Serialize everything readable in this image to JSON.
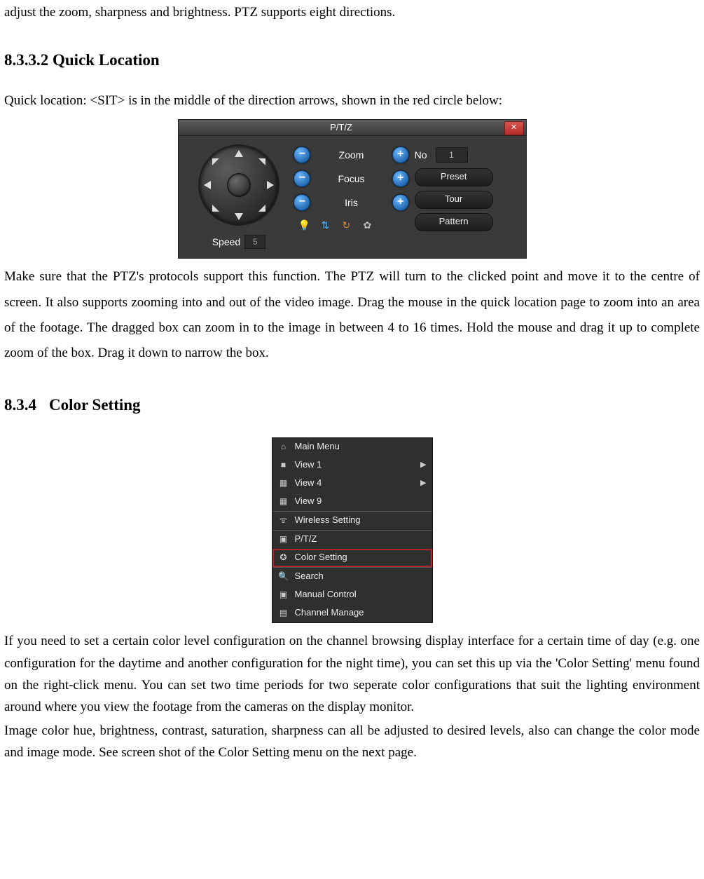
{
  "intro_line": "adjust the zoom, sharpness and brightness. PTZ supports eight directions.",
  "heading_quick_location": "8.3.3.2 Quick Location",
  "quick_location_intro": "Quick location: <SIT> is in the middle of the direction arrows, shown in the red circle below:",
  "ptz_panel": {
    "title": "P/T/Z",
    "close_glyph": "✕",
    "speed_label": "Speed",
    "speed_value": "5",
    "rows": {
      "zoom": {
        "label": "Zoom",
        "minus": "−",
        "plus": "+"
      },
      "focus": {
        "label": "Focus",
        "minus": "−",
        "plus": "+"
      },
      "iris": {
        "label": "Iris",
        "minus": "−",
        "plus": "+"
      }
    },
    "toolbar": {
      "bulb": "💡",
      "flip": "⇅",
      "reset": "↻",
      "gear": "✿"
    },
    "no_label": "No",
    "no_value": "1",
    "buttons": {
      "preset": "Preset",
      "tour": "Tour",
      "pattern": "Pattern"
    }
  },
  "quick_location_body": "Make sure that the PTZ's protocols support this function. The PTZ will turn to the clicked point and move it to the centre of screen. It also supports zooming into and out of the video image. Drag the mouse in the quick location page to zoom into an area of the footage. The dragged box can zoom in to the image in between 4 to 16 times. Hold the mouse and drag it up to complete zoom of the box. Drag it down to narrow the box.",
  "heading_color_setting_num": "8.3.4",
  "heading_color_setting_text": "Color Setting",
  "ctx_menu": {
    "items": [
      {
        "icon": "⌂",
        "label": "Main Menu",
        "sub": false,
        "sep": false,
        "hl": false
      },
      {
        "icon": "■",
        "label": "View 1",
        "sub": true,
        "sep": false,
        "hl": false
      },
      {
        "icon": "▦",
        "label": "View 4",
        "sub": true,
        "sep": false,
        "hl": false
      },
      {
        "icon": "▦",
        "label": "View 9",
        "sub": false,
        "sep": false,
        "hl": false
      },
      {
        "icon": "ᯤ",
        "label": "Wireless Setting",
        "sub": false,
        "sep": true,
        "hl": false
      },
      {
        "icon": "▣",
        "label": "P/T/Z",
        "sub": false,
        "sep": true,
        "hl": false
      },
      {
        "icon": "✪",
        "label": "Color Setting",
        "sub": false,
        "sep": false,
        "hl": true
      },
      {
        "icon": "🔍",
        "label": "Search",
        "sub": false,
        "sep": true,
        "hl": false
      },
      {
        "icon": "▣",
        "label": "Manual Control",
        "sub": false,
        "sep": false,
        "hl": false
      },
      {
        "icon": "▤",
        "label": "Channel Manage",
        "sub": false,
        "sep": false,
        "hl": false
      }
    ]
  },
  "color_setting_p1": "If you need to set a certain color level configuration on the channel browsing display interface for a certain time of day (e.g. one configuration for the daytime and another configuration for the night time), you can set this up via the 'Color Setting' menu found on the right-click menu. You can set two time periods for two seperate color configurations that suit the lighting environment around where you view the footage from the cameras on the display monitor.",
  "color_setting_p2": "Image color hue, brightness, contrast, saturation, sharpness can all be adjusted to desired levels, also can change the color mode and image mode. See screen shot of the Color Setting menu on the next page."
}
